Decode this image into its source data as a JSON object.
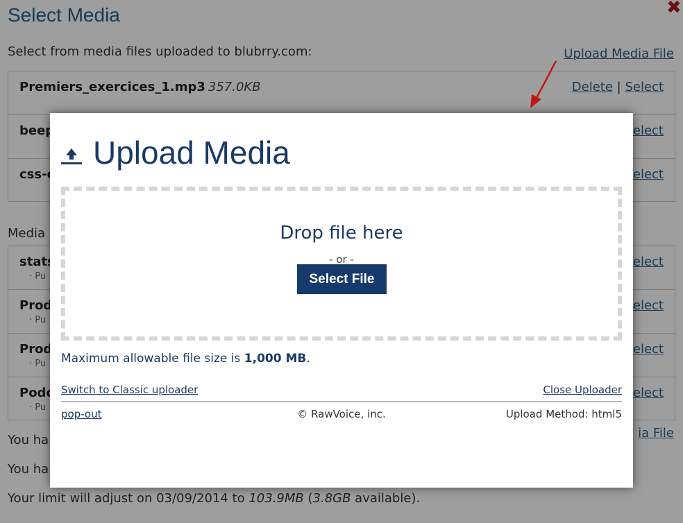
{
  "background": {
    "title": "Select Media",
    "close_glyph": "✖",
    "subtitle": "Select from media files uploaded to blubrry.com:",
    "upload_link": "Upload Media File",
    "files": [
      {
        "name": "Premiers_exercices_1.mp3",
        "size": "357.0KB",
        "sub": "",
        "delete": "Delete",
        "sep": "|",
        "select": "Select"
      },
      {
        "name": "beep",
        "size": "",
        "sub": "",
        "delete": "",
        "sep": "",
        "select": "elect"
      },
      {
        "name": "css-c",
        "size": "",
        "sub": "",
        "delete": "",
        "sep": "",
        "select": "elect"
      }
    ],
    "section_label": "Media",
    "media_files": [
      {
        "name": "stats",
        "sub": "· Pu",
        "select": "elect"
      },
      {
        "name": "Prod",
        "sub": "· Pu",
        "select": "elect"
      },
      {
        "name": "Prod",
        "sub": "· Pu",
        "select": "elect"
      },
      {
        "name": "Podc",
        "sub": "· Pu",
        "select": "elect"
      }
    ],
    "note1": "You ha",
    "note1_link": "ia File",
    "note2": "You ha",
    "limit_prefix": "Your limit will adjust on 03/09/2014 to ",
    "limit_value": "103.9MB",
    "limit_open": " (",
    "limit_avail": "3.8GB",
    "limit_suffix": " available)."
  },
  "modal": {
    "icon": "upload-icon",
    "title": "Upload Media",
    "drop_text": "Drop file here",
    "or_text": "- or -",
    "select_button": "Select File",
    "max_prefix": "Maximum allowable file size is ",
    "max_value": "1,000 MB",
    "max_suffix": ".",
    "switch_link": "Switch to Classic uploader",
    "close_link": "Close Uploader",
    "popout_link": "pop-out",
    "copyright": "© RawVoice, inc.",
    "method": "Upload Method: html5"
  },
  "colors": {
    "accent": "#163a6c",
    "link": "#2b5f8a",
    "arrow": "#c01818"
  }
}
